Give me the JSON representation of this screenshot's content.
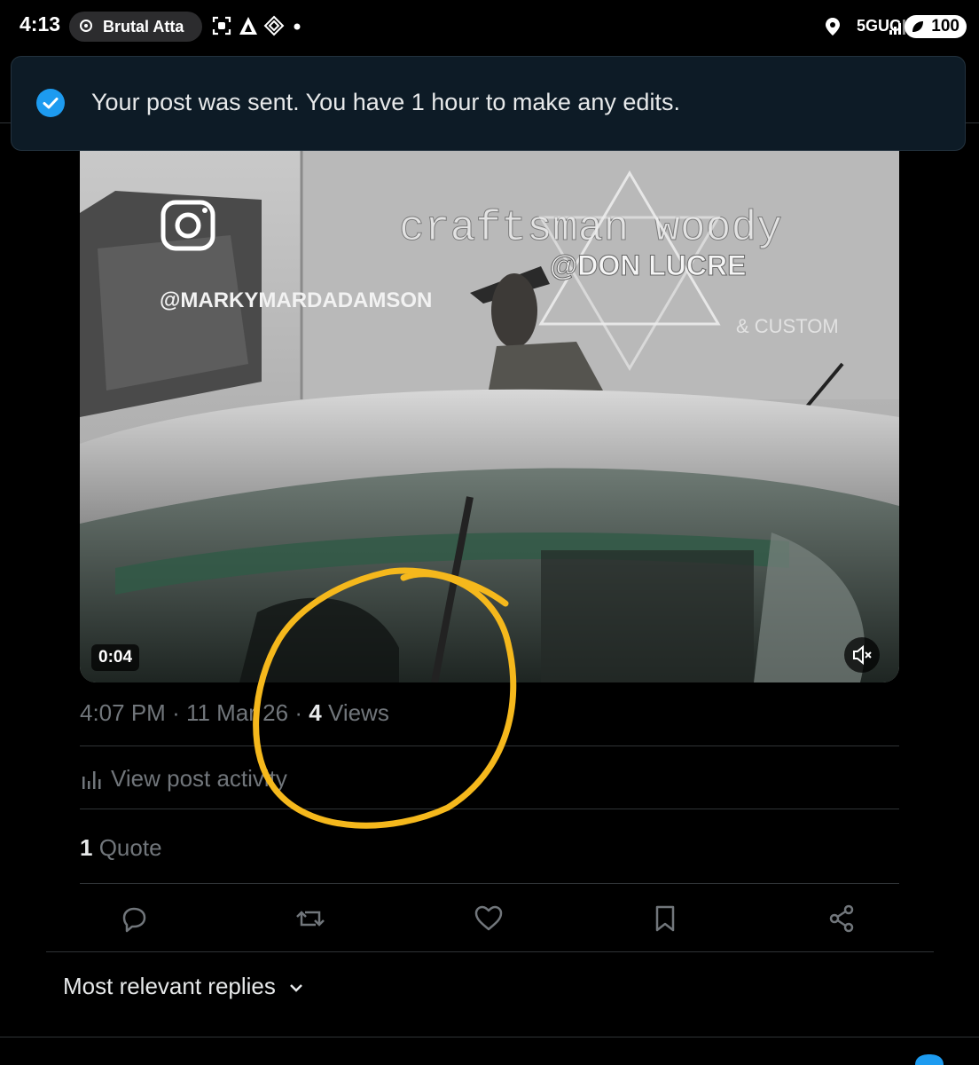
{
  "status_bar": {
    "time": "4:13",
    "notification_app": "Brutal Atta",
    "network": "5GUC",
    "battery": "100"
  },
  "toast": {
    "message": "Your post was sent. You have 1 hour to make any edits."
  },
  "video": {
    "duration": "0:04",
    "overlay_watermark": "@MARKYMARDADAMSON",
    "van_text": "craftsman woody",
    "van_watermark": "@DON LUCRE",
    "van_subtext": "& CUSTOM",
    "muted": true
  },
  "post_meta": {
    "time": "4:07 PM",
    "separator": "·",
    "date": "11 Mar 26",
    "views_count": "4",
    "views_label": "Views"
  },
  "post_activity_label": "View post activity",
  "quotes": {
    "count": "1",
    "label": "Quote"
  },
  "actions": [
    "reply",
    "repost",
    "like",
    "bookmark",
    "share"
  ],
  "replies_sort_label": "Most relevant replies",
  "colors": {
    "background": "#000000",
    "accent_blue": "#1d9bf0",
    "muted_text": "#71767b",
    "annotation_yellow": "#f5b81c"
  }
}
